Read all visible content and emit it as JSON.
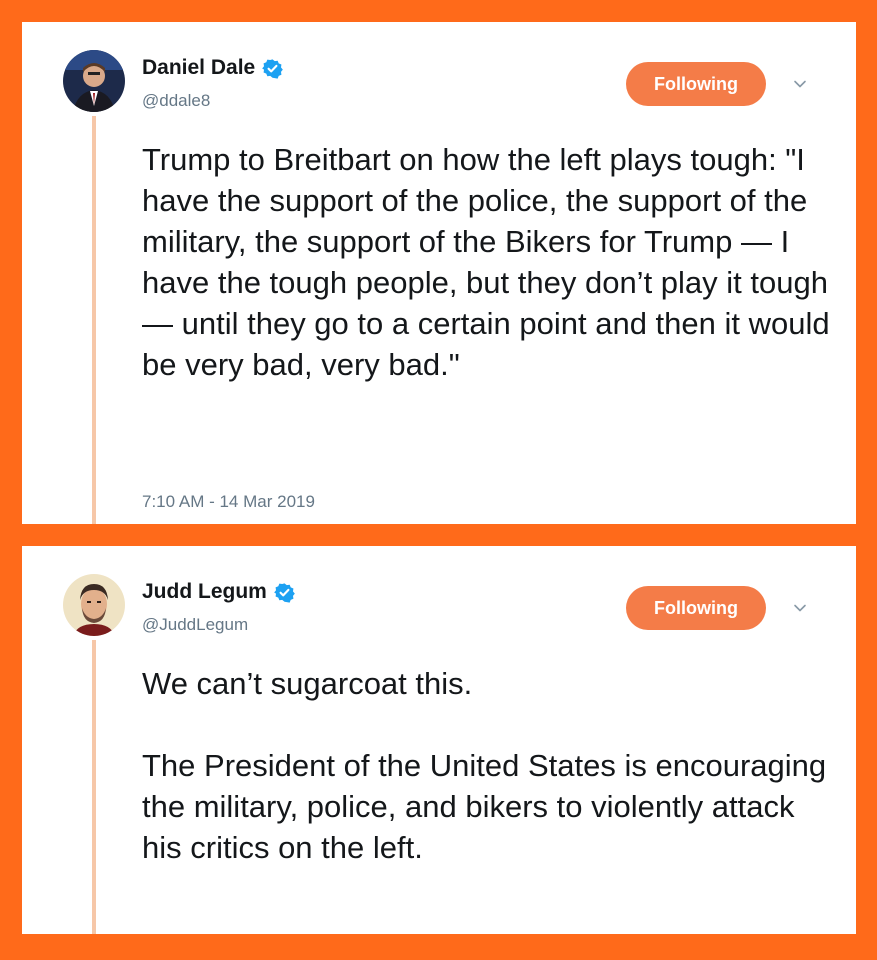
{
  "colors": {
    "background": "#ff6a1a",
    "follow_button": "#f47c48",
    "verified_badge": "#1da1f2",
    "thread_line": "#f6c7a8"
  },
  "tweets": [
    {
      "name": "Daniel Dale",
      "handle": "@ddale8",
      "verified": true,
      "follow_label": "Following",
      "text": "Trump to Breitbart on how the left plays tough: \"I have the support of the police, the support of the military, the support of the Bikers for Trump — I have the tough people, but they don’t play it tough — until they go to a certain point and then it would be very bad, very bad.\"",
      "timestamp": "7:10 AM - 14 Mar 2019",
      "icons": [
        "avatar",
        "verified-badge-icon",
        "chevron-down-icon"
      ]
    },
    {
      "name": "Judd Legum",
      "handle": "@JuddLegum",
      "verified": true,
      "follow_label": "Following",
      "text": "We can’t sugarcoat this.\n\nThe President of the United States is encouraging the military, police, and bikers to violently attack his critics on the left.",
      "icons": [
        "avatar",
        "verified-badge-icon",
        "chevron-down-icon"
      ]
    }
  ]
}
